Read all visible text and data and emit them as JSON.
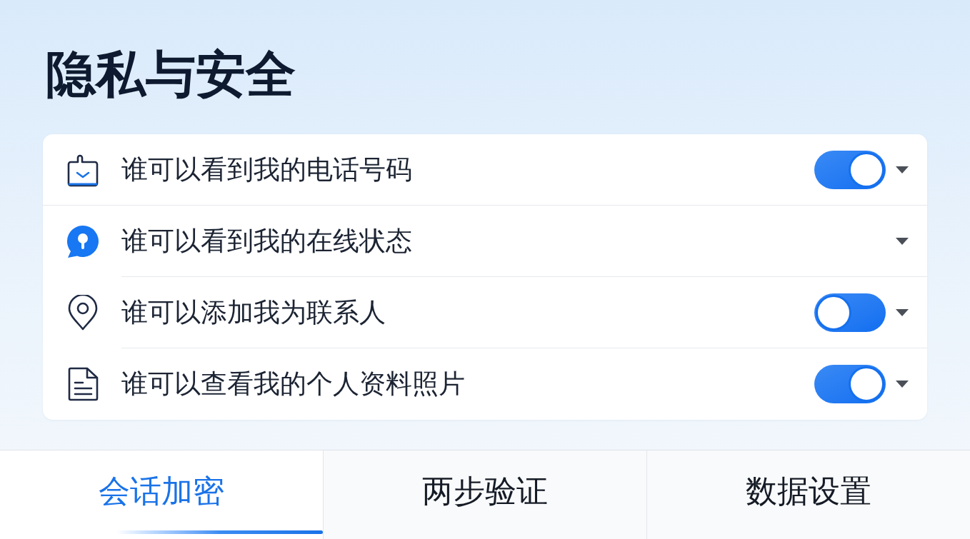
{
  "page": {
    "title": "隐私与安全"
  },
  "settings": [
    {
      "kind": "toggle",
      "label": "谁可以看到我的电话号码",
      "on": true
    },
    {
      "kind": "dropdown",
      "label": "谁可以看到我的在线状态"
    },
    {
      "kind": "toggle",
      "label": "谁可以添加我为联系人",
      "on": false
    },
    {
      "kind": "toggle",
      "label": "谁可以查看我的个人资料照片",
      "on": true
    }
  ],
  "tabs": [
    {
      "label": "会话加密",
      "selected": true
    },
    {
      "label": "两步验证",
      "selected": false
    },
    {
      "label": "数据设置",
      "selected": false
    }
  ]
}
